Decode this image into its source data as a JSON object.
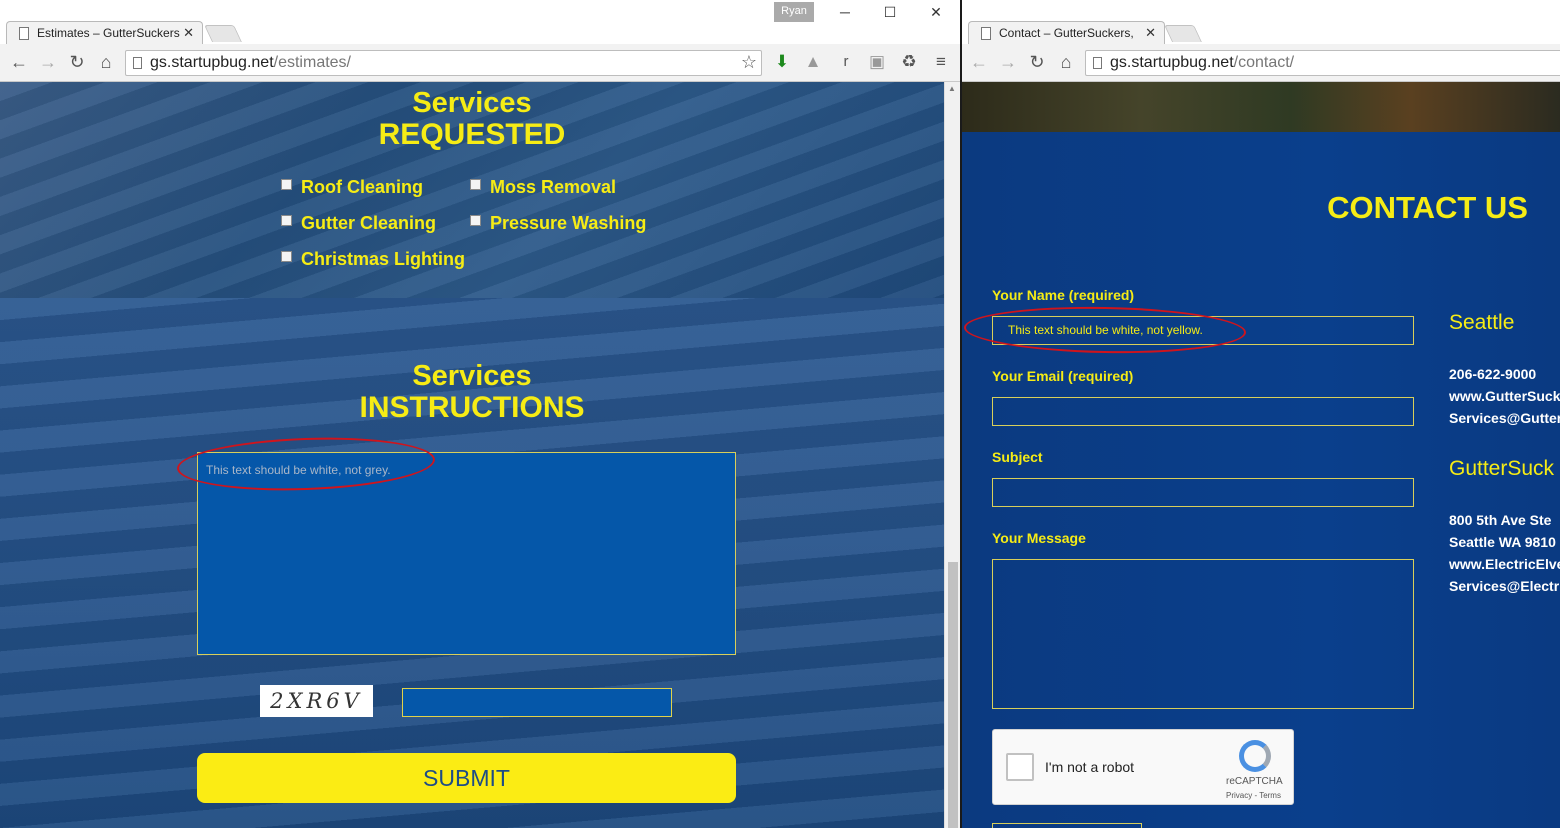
{
  "left_window": {
    "tab_title": "Estimates – GutterSuckers",
    "user_badge": "Ryan",
    "controls": {
      "minimize": "─",
      "maximize": "☐",
      "close": "✕"
    },
    "url_domain": "gs.startupbug.net",
    "url_path": "/estimates/",
    "page": {
      "services_requested": {
        "line1": "Services",
        "line2": "REQUESTED"
      },
      "checkboxes": [
        "Roof Cleaning",
        "Moss Removal",
        "Gutter Cleaning",
        "Pressure Washing",
        "Christmas Lighting"
      ],
      "services_instructions": {
        "line1": "Services",
        "line2": "INSTRUCTIONS"
      },
      "instructions_text": "This text should be white, not grey.",
      "captcha_code": "2XR6V",
      "submit_label": "SUBMIT"
    }
  },
  "right_window": {
    "tab_title": "Contact – GutterSuckers,",
    "url_domain": "gs.startupbug.net",
    "url_path": "/contact/",
    "page": {
      "heading": "CONTACT US",
      "fields": {
        "name_label": "Your Name (required)",
        "name_value": "This text should be white, not yellow.",
        "email_label": "Your Email (required)",
        "subject_label": "Subject",
        "message_label": "Your Message"
      },
      "recaptcha": {
        "label": "I'm not a robot",
        "brand": "reCAPTCHA",
        "terms": "Privacy - Terms"
      },
      "office1": {
        "city": "Seattle",
        "phone": "206-622-9000",
        "web": "www.GutterSucke",
        "email": "Services@Gutters"
      },
      "office2": {
        "name": "GutterSuck",
        "address1": "800 5th Ave Ste",
        "address2": "Seattle WA 9810",
        "web": "www.ElectricElve",
        "email": "Services@Electri"
      }
    }
  },
  "colors": {
    "accent_yellow": "#f6ec15",
    "brand_blue": "#0b3c84",
    "annotation_red": "#d0141c"
  }
}
